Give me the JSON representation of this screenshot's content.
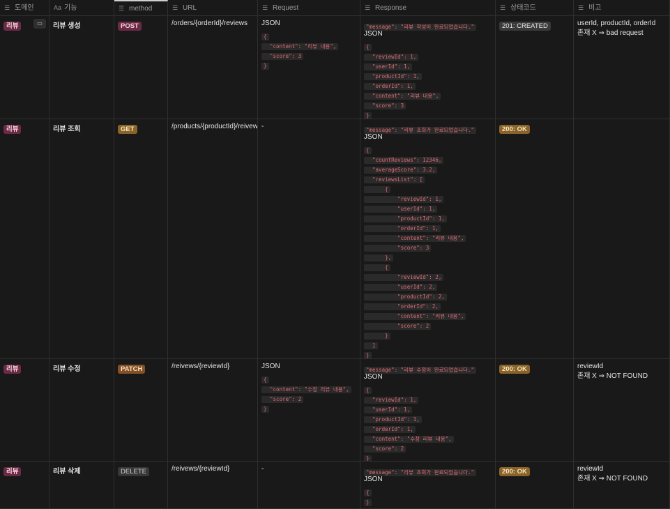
{
  "headers": [
    {
      "icon": "☰",
      "label": "도메인"
    },
    {
      "icon": "Aa",
      "label": "기능"
    },
    {
      "icon": "☰",
      "label": "method"
    },
    {
      "icon": "☰",
      "label": "URL"
    },
    {
      "icon": "☰",
      "label": "Request"
    },
    {
      "icon": "☰",
      "label": "Response"
    },
    {
      "icon": "☰",
      "label": "상태코드"
    },
    {
      "icon": "☰",
      "label": "비고"
    }
  ],
  "open_label": "열기",
  "rows": [
    {
      "domain": "리뷰",
      "name": "리뷰 생성",
      "method": "POST",
      "url": "/orders/{orderId}/reviews",
      "request": {
        "title": "JSON",
        "lines": [
          "{",
          "  \"content\": \"리뷰 내용\",",
          "  \"score\": 3",
          "}"
        ]
      },
      "response": {
        "message": "\"message\": \"리뷰 작성이 완료되었습니다.\"",
        "title": "JSON",
        "lines": [
          "{",
          "  \"reviewId\": 1,",
          "  \"userId\": 1,",
          "  \"productId\": 1,",
          "  \"orderId\": 1,",
          "  \"content\": \"리뷰 내용\",",
          "  \"score\": 3",
          "}"
        ]
      },
      "status": "201: CREATED",
      "note": [
        "userId, productId, orderId",
        "존재 X ⇒ bad request"
      ]
    },
    {
      "domain": "리뷰",
      "name": "리뷰 조회",
      "method": "GET",
      "url": "/products/{productId}/reivews",
      "request": {
        "title": "-",
        "lines": []
      },
      "response": {
        "message": "\"message\": \"리뷰 조회가 완료되었습니다.\"",
        "title": "JSON",
        "lines": [
          "{",
          "  \"countReviews\": 12346,",
          "  \"averageScore\": 3.2,",
          "  \"reviewsList\": [",
          "      {",
          "          \"reviewId\": 1,",
          "          \"userId\": 1,",
          "          \"productId\": 1,",
          "          \"orderId\": 1,",
          "          \"content\": \"리뷰 내용\",",
          "          \"score\": 3",
          "      },",
          "      {",
          "          \"reviewId\": 2,",
          "          \"userId\": 2,",
          "          \"productId\": 2,",
          "          \"orderId\": 2,",
          "          \"content\": \"리뷰 내용\",",
          "          \"score\": 2",
          "      }",
          "  ]",
          "}"
        ]
      },
      "status": "200: OK",
      "note": []
    },
    {
      "domain": "리뷰",
      "name": "리뷰 수정",
      "method": "PATCH",
      "url": "/reivews/{reviewId}",
      "request": {
        "title": "JSON",
        "lines": [
          "{",
          "  \"content\": \"수정 리뷰 내용\",",
          "  \"score\": 2",
          "}"
        ]
      },
      "response": {
        "message": "\"message\": \"리뷰 수정이 완료되었습니다.\"",
        "title": "JSON",
        "lines": [
          "{",
          "  \"reviewId\": 1,",
          "  \"userId\": 1,",
          "  \"productId\": 1,",
          "  \"orderId\": 1,",
          "  \"content\": \"수정 리뷰 내용\",",
          "  \"score\": 2",
          "}"
        ]
      },
      "status": "200: OK",
      "note": [
        "reviewId",
        "존재 X ⇒ NOT FOUND"
      ]
    },
    {
      "domain": "리뷰",
      "name": "리뷰 삭제",
      "method": "DELETE",
      "url": "/reivews/{reviewId}",
      "request": {
        "title": "-",
        "lines": []
      },
      "response": {
        "message": "\"message\": \"리뷰 조회가 완료되었습니다.\"",
        "title": "JSON",
        "lines": [
          "{",
          "}"
        ]
      },
      "status": "200: OK",
      "note": [
        "reviewId",
        "존재 X ⇒ NOT FOUND"
      ]
    }
  ]
}
